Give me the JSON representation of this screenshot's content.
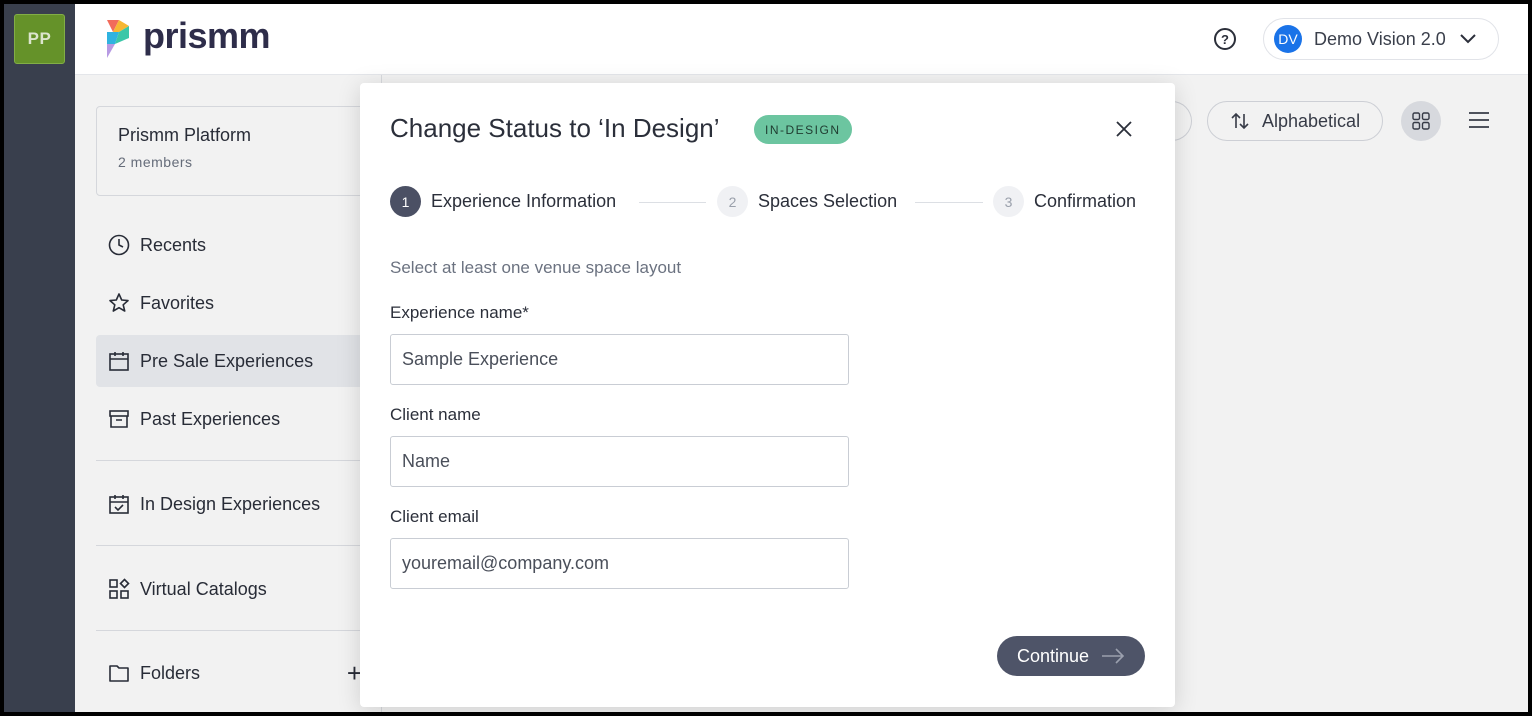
{
  "workspace": {
    "initials": "PP"
  },
  "header": {
    "logo_text": "prismm",
    "help_icon": "question-circle-icon",
    "account": {
      "initials": "DV",
      "name": "Demo Vision 2.0"
    }
  },
  "sidebar": {
    "team": {
      "name": "Prismm Platform",
      "members": "2 members"
    },
    "items": [
      {
        "label": "Recents",
        "icon": "clock-icon"
      },
      {
        "label": "Favorites",
        "icon": "star-icon"
      },
      {
        "label": "Pre Sale Experiences",
        "icon": "calendar-icon",
        "active": true
      },
      {
        "label": "Past Experiences",
        "icon": "archive-icon"
      },
      {
        "label": "In Design Experiences",
        "icon": "calendar-check-icon"
      },
      {
        "label": "Virtual Catalogs",
        "icon": "catalog-icon"
      },
      {
        "label": "Folders",
        "icon": "folder-icon"
      }
    ],
    "add_folder": "+"
  },
  "toolbar": {
    "sort_label": "Alphabetical",
    "view_grid": "grid-icon",
    "view_list": "list-icon"
  },
  "modal": {
    "title": "Change Status to ‘In Design’",
    "badge": "IN-DESIGN",
    "steps": [
      {
        "num": "1",
        "label": "Experience Information",
        "active": true
      },
      {
        "num": "2",
        "label": "Spaces Selection",
        "active": false
      },
      {
        "num": "3",
        "label": "Confirmation",
        "active": false
      }
    ],
    "helper": "Select at least one venue space layout",
    "fields": {
      "experience_name": {
        "label": "Experience name*",
        "placeholder": "Sample Experience"
      },
      "client_name": {
        "label": "Client name",
        "placeholder": "Name"
      },
      "client_email": {
        "label": "Client email",
        "placeholder": "youremail@company.com"
      }
    },
    "continue_label": "Continue"
  },
  "colors": {
    "accent": "#4e5468",
    "badge_bg": "#6cc5a0",
    "workspace_badge": "#6b9a2c",
    "avatar": "#1a73e8",
    "rail": "#3d4352"
  }
}
